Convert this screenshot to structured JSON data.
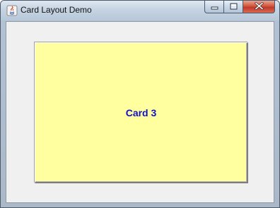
{
  "window": {
    "title": "Card Layout Demo",
    "app_icon": "java-icon"
  },
  "caption_buttons": {
    "minimize_icon": "minimize-icon",
    "maximize_icon": "maximize-icon",
    "close_icon": "close-icon"
  },
  "card": {
    "label": "Card 3",
    "background_color": "#ffffa0",
    "text_color": "#1010c8"
  }
}
